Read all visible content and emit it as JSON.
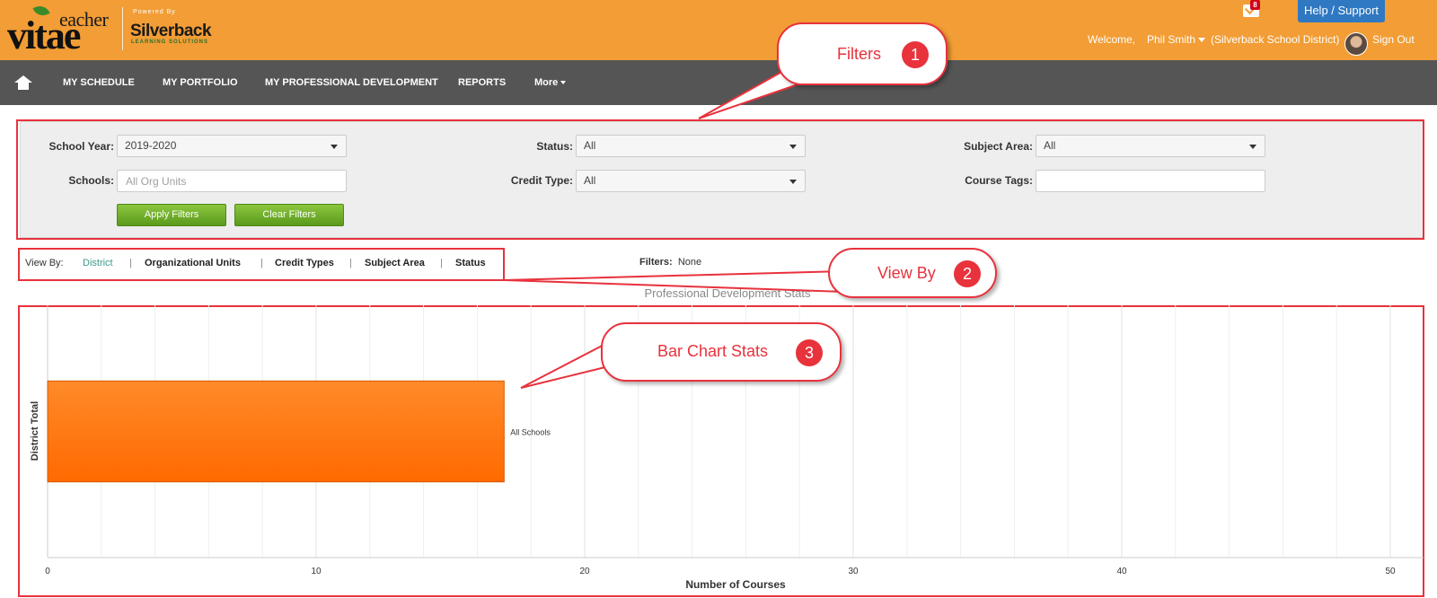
{
  "header": {
    "logo_teacher": "eacher",
    "logo_vitae": "vitae",
    "powered_by": "Powered By",
    "silverback": "Silverback",
    "learning": "LEARNING SOLUTIONS",
    "mail_badge": "8",
    "help_button": "Help / Support",
    "welcome": "Welcome,",
    "user_name": "Phil Smith",
    "district": "(Silverback School District)",
    "sign_out": "Sign Out",
    "color": "#f29d35"
  },
  "nav": {
    "items": [
      "MY SCHEDULE",
      "MY PORTFOLIO",
      "MY PROFESSIONAL DEVELOPMENT",
      "REPORTS",
      "More"
    ],
    "color": "#555555"
  },
  "filters": {
    "school_year_label": "School Year:",
    "school_year_value": "2019-2020",
    "schools_label": "Schools:",
    "schools_placeholder": "All Org Units",
    "status_label": "Status:",
    "status_value": "All",
    "credit_type_label": "Credit Type:",
    "credit_type_value": "All",
    "subject_area_label": "Subject Area:",
    "subject_area_value": "All",
    "course_tags_label": "Course Tags:",
    "course_tags_value": "",
    "apply_button": "Apply Filters",
    "clear_button": "Clear Filters"
  },
  "view_by": {
    "label": "View By:",
    "options": [
      "District",
      "Organizational Units",
      "Credit Types",
      "Subject Area",
      "Status"
    ],
    "active": "District"
  },
  "applied_filters": {
    "label": "Filters:",
    "value": "None"
  },
  "chart_title": "Professional Development Stats",
  "chart_data": {
    "type": "bar",
    "orientation": "horizontal",
    "categories": [
      "District Total"
    ],
    "series": [
      {
        "values": [
          17
        ]
      }
    ],
    "data_labels": [
      "All Schools"
    ],
    "title": "Professional Development Stats",
    "xlabel": "Number of Courses",
    "ylabel": "District Total",
    "xlim": [
      0,
      50
    ],
    "xticks": [
      0,
      10,
      20,
      30,
      40,
      50
    ],
    "grid": true,
    "bar_color": "#ff7f1a"
  },
  "callouts": {
    "filters": {
      "text": "Filters",
      "num": "1"
    },
    "view_by": {
      "text": "View By",
      "num": "2"
    },
    "bar_chart": {
      "text": "Bar Chart Stats",
      "num": "3"
    },
    "color": "#e8323c"
  }
}
